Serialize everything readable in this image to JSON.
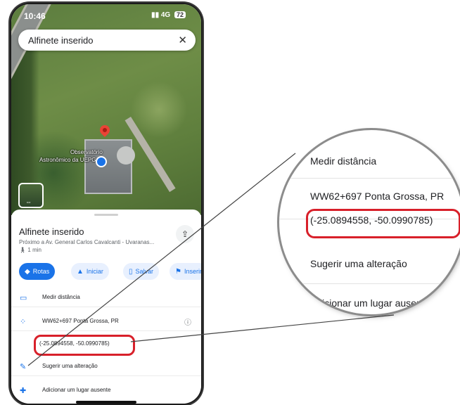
{
  "status_bar": {
    "time": "10:46",
    "network": "4G",
    "battery": "72"
  },
  "search_bar": {
    "title": "Alfinete inserido",
    "close_icon": "close-icon"
  },
  "map": {
    "place_label_line1": "Observatório",
    "place_label_line2": "Astronômico da UEPG"
  },
  "place_sheet": {
    "title": "Alfinete inserido",
    "address": "Próximo a Av. General Carlos Cavalcanti - Uvaranas...",
    "walk_time": "1 min",
    "actions": [
      {
        "label": "Rotas",
        "icon": "directions-icon"
      },
      {
        "label": "Iniciar",
        "icon": "navigation-arrow-icon"
      },
      {
        "label": "Salvar",
        "icon": "bookmark-icon"
      },
      {
        "label": "Inserir",
        "icon": "flag-icon"
      }
    ],
    "rows": [
      {
        "label": "Medir distância",
        "icon": "ruler-icon"
      },
      {
        "label": "WW62+697 Ponta Grossa, PR",
        "icon": "plus-code-icon"
      },
      {
        "label": "(-25.0894558, -50.0990785)",
        "icon": ""
      },
      {
        "label": "Sugerir uma alteração",
        "icon": "pencil-icon"
      },
      {
        "label": "Adicionar um lugar ausente",
        "icon": "add-place-icon"
      }
    ]
  },
  "magnifier": {
    "rows": [
      {
        "label": "Medir distância"
      },
      {
        "label": "WW62+697 Ponta Grossa, PR"
      },
      {
        "label": "(-25.0894558, -50.0990785)"
      },
      {
        "label": "Sugerir uma alteração"
      },
      {
        "label": "Adicionar um lugar ausente"
      }
    ]
  },
  "colors": {
    "accent": "#1a73e8",
    "highlight": "#d8202a",
    "pin": "#ea4335"
  }
}
